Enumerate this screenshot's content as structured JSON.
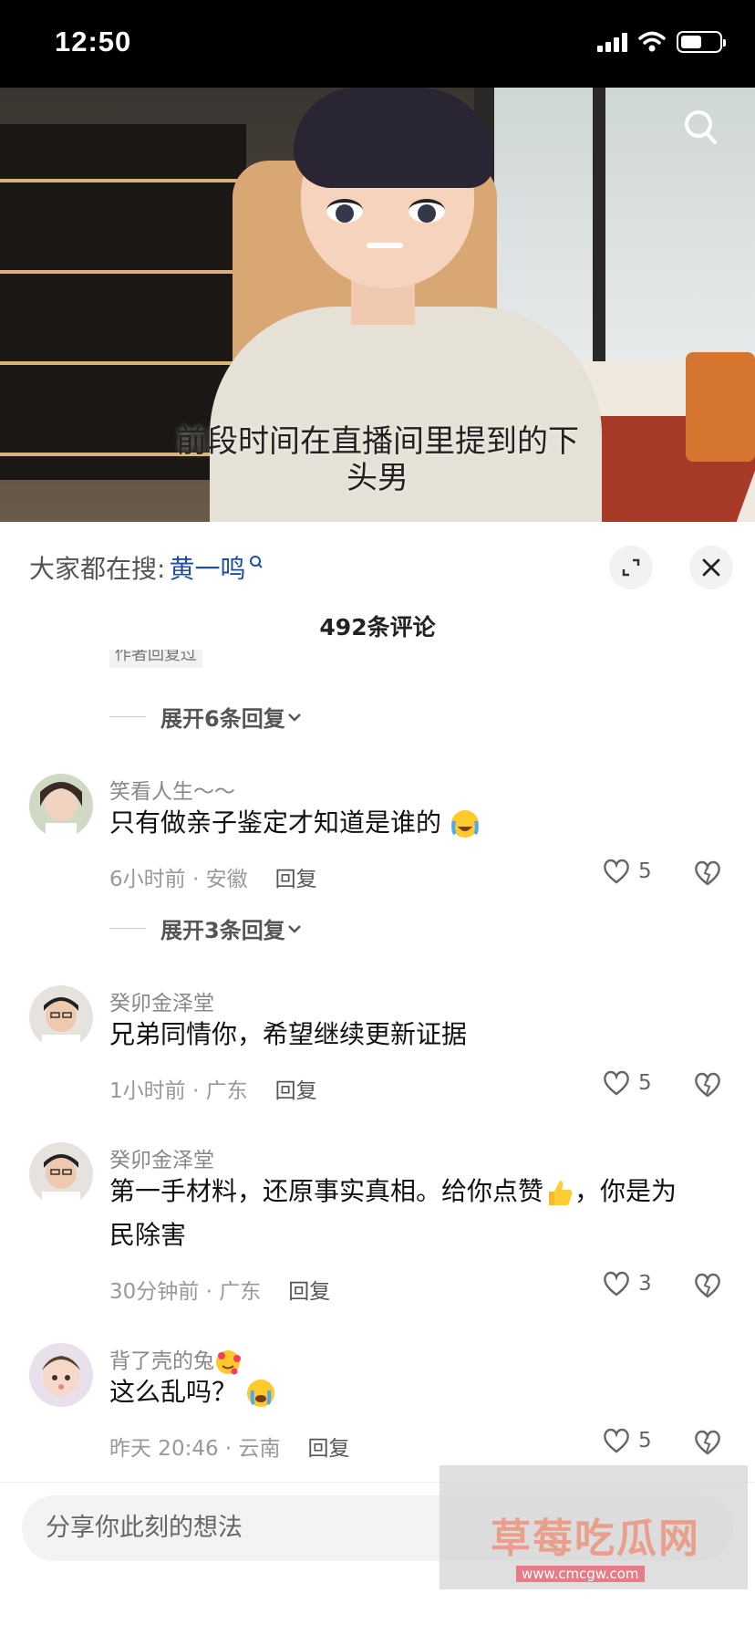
{
  "status_bar": {
    "time": "12:50"
  },
  "video": {
    "subtitle_line1": "前段时间在直播间里提到的下",
    "subtitle_line2": "头男"
  },
  "sheet": {
    "search_prefix": "大家都在搜:",
    "search_keyword": "黄一鸣",
    "comment_count": "492条评论",
    "partial_label": "作者回复过"
  },
  "comments": [
    {
      "expand_before": "展开6条回复",
      "user": "笑看人生～～",
      "text": "只有做亲子鉴定才知道是谁的",
      "emoji": "sob-laugh-emoji",
      "meta": "6小时前 · 安徽",
      "reply": "回复",
      "likes": "5",
      "expand_after": "展开3条回复"
    },
    {
      "user": "癸卯金泽堂",
      "text": "兄弟同情你，希望继续更新证据",
      "meta": "1小时前 · 广东",
      "reply": "回复",
      "likes": "5"
    },
    {
      "user": "癸卯金泽堂",
      "text_line1": "第一手材料，还原事实真相。给你点赞",
      "text_line1_after": "，你是为",
      "text_line2": "民除害",
      "emoji": "thumbs-up-emoji",
      "meta": "30分钟前 · 广东",
      "reply": "回复",
      "likes": "3"
    },
    {
      "user": "背了壳的兔",
      "user_emoji": "hearts-face-emoji",
      "text": "这么乱吗？",
      "emoji": "crying-emoji",
      "meta": "昨天 20:46 · 云南",
      "reply": "回复",
      "likes": "5"
    }
  ],
  "input": {
    "placeholder": "分享你此刻的想法"
  },
  "watermark": {
    "title": "草莓吃瓜网",
    "url": "www.cmcgw.com"
  },
  "colors": {
    "keyword": "#1f4fa0",
    "text": "#111111",
    "muted": "#999999"
  }
}
